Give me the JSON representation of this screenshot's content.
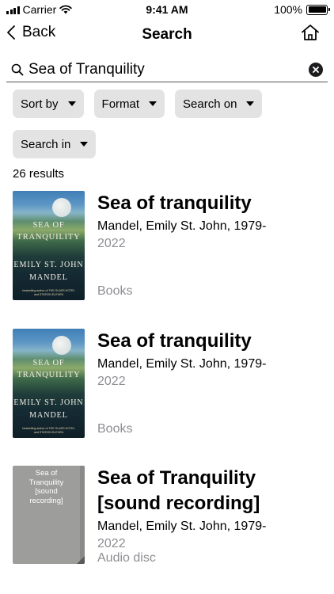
{
  "status_bar": {
    "carrier": "Carrier",
    "time": "9:41 AM",
    "battery": "100%",
    "battery_level": 1.0
  },
  "nav": {
    "back_label": "Back",
    "title": "Search",
    "home_icon": "home-icon"
  },
  "search": {
    "value": "Sea of Tranquility",
    "placeholder": ""
  },
  "filters": [
    {
      "label": "Sort by"
    },
    {
      "label": "Format"
    },
    {
      "label": "Search on"
    },
    {
      "label": "Search in"
    }
  ],
  "results_count": "26 results",
  "results": [
    {
      "title": "Sea of tranquility",
      "author": "Mandel, Emily St. John, 1979-",
      "year": "2022",
      "format": "Books",
      "cover": {
        "title_line1": "SEA OF",
        "title_line2": "TRANQUILITY",
        "author_line1": "EMILY ST. JOHN",
        "author_line2": "MANDEL",
        "small_line1": "bestselling author of THE GLASS HOTEL",
        "small_line2": "and STATION ELEVEN"
      }
    },
    {
      "title": "Sea of tranquility",
      "author": "Mandel, Emily St. John, 1979-",
      "year": "2022",
      "format": "Books",
      "cover": {
        "title_line1": "SEA OF",
        "title_line2": "TRANQUILITY",
        "author_line1": "EMILY ST. JOHN",
        "author_line2": "MANDEL",
        "small_line1": "bestselling author of THE GLASS HOTEL",
        "small_line2": "and STATION ELEVEN"
      }
    },
    {
      "title_line1": "Sea of Tranquility",
      "title_line2": "[sound recording]",
      "author": "Mandel, Emily St. John, 1979-",
      "year": "2022",
      "format": "Audio disc",
      "cover": {
        "line1": "Sea of",
        "line2": "Tranquility",
        "line3": "[sound",
        "line4": "recording]"
      }
    }
  ]
}
